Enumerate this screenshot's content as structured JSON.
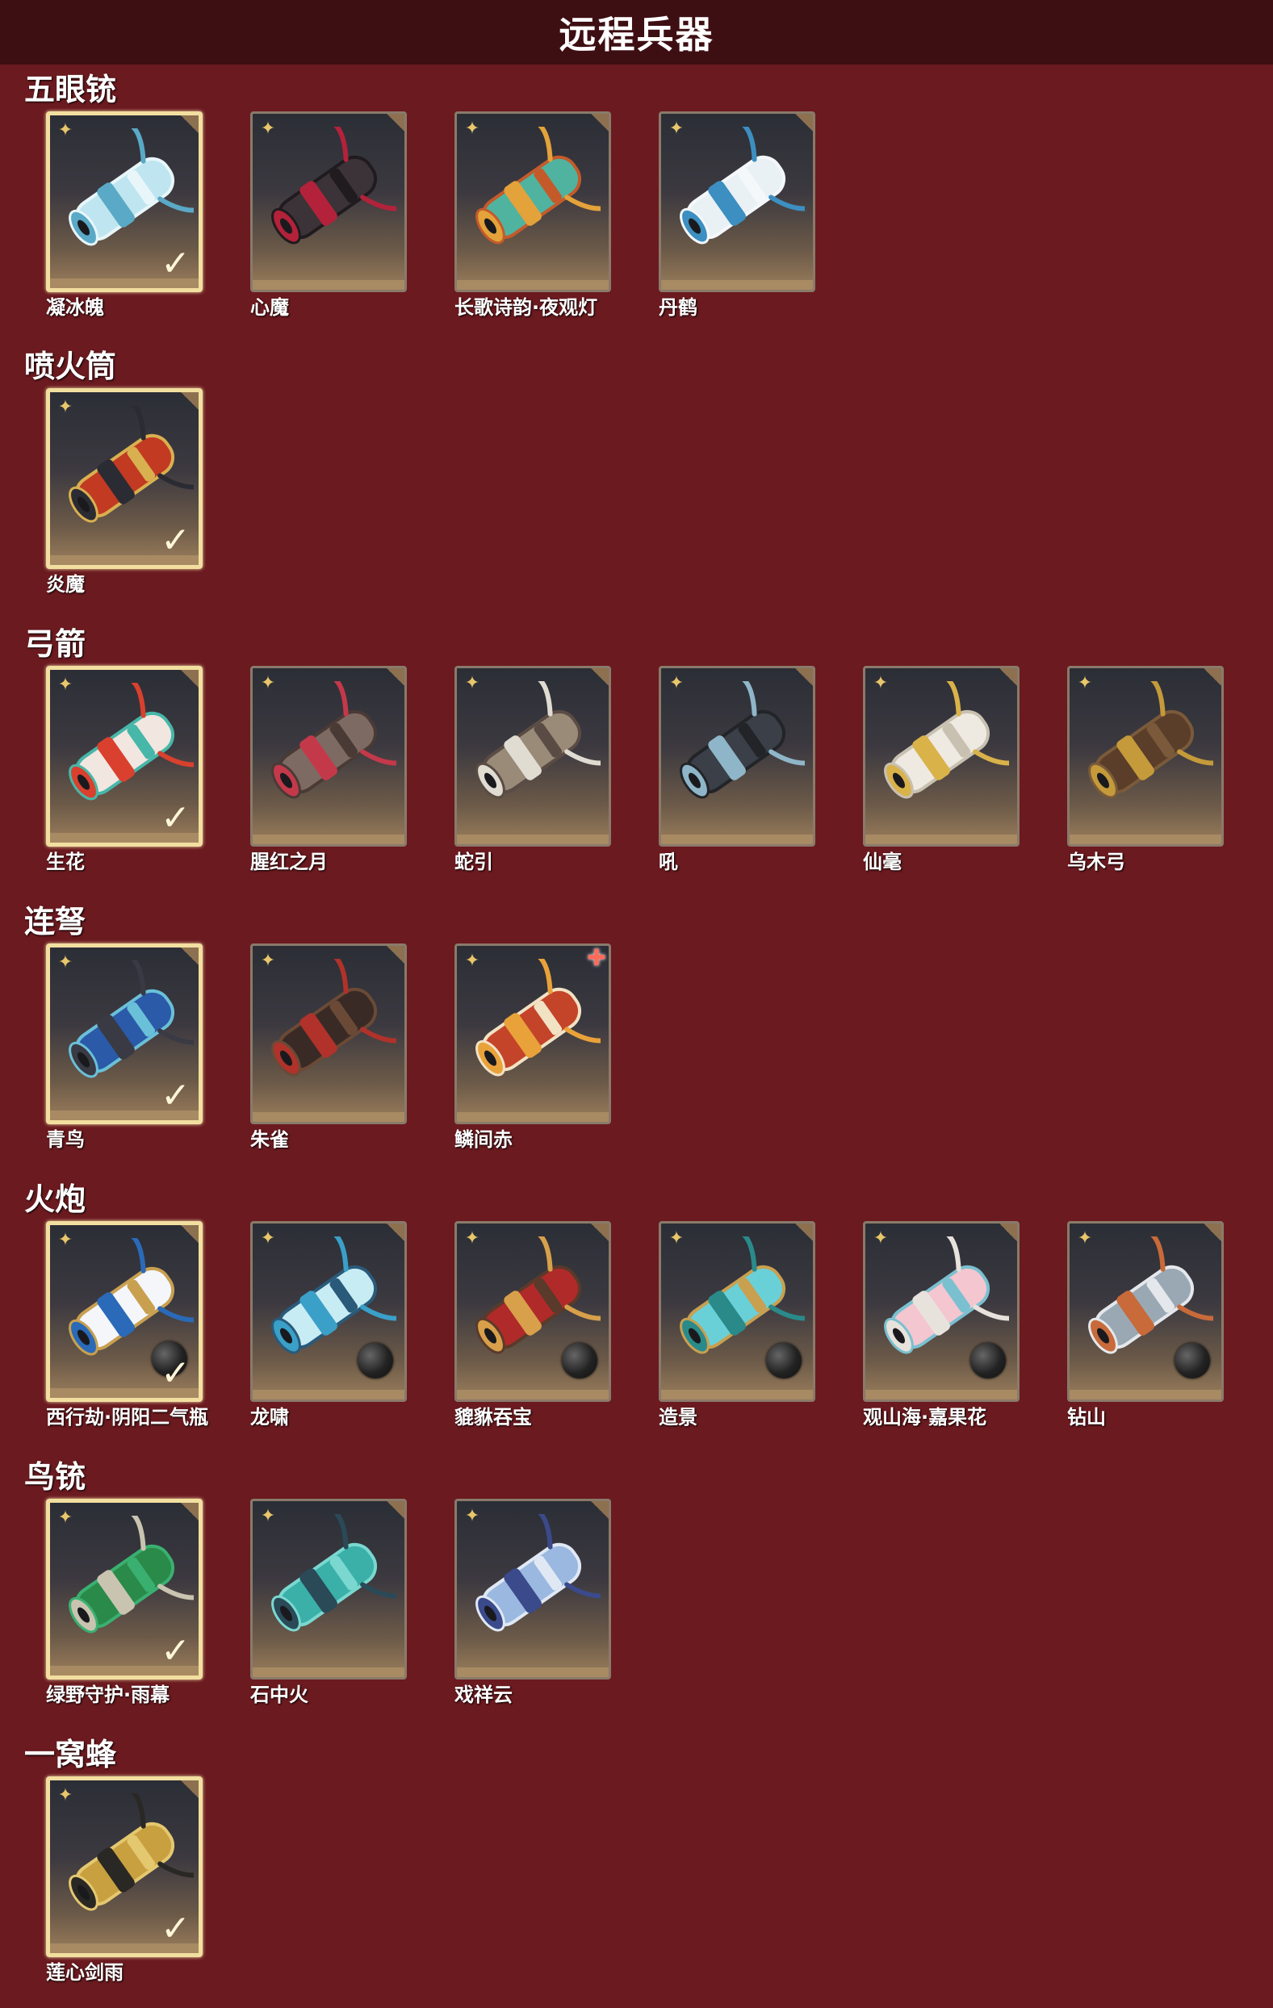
{
  "page_title": "远程兵器",
  "palette": {
    "background": "#6b1a1f",
    "title_bar": "#3d0e12",
    "owned_border": "#f2dfa0"
  },
  "sections": [
    {
      "title": "五眼铳",
      "items": [
        {
          "name": "凝冰魄",
          "owned": true,
          "art": [
            "#bfe6f0",
            "#5aa9c6",
            "#e8f6fa"
          ]
        },
        {
          "name": "心魔",
          "owned": false,
          "art": [
            "#3b3338",
            "#b3223a",
            "#1f1b1e"
          ]
        },
        {
          "name": "长歌诗韵·夜观灯",
          "owned": false,
          "art": [
            "#4fb3a0",
            "#e3a23a",
            "#c45a2a"
          ]
        },
        {
          "name": "丹鹤",
          "owned": false,
          "art": [
            "#e9f1f5",
            "#3c8fc0",
            "#f4f8fb"
          ]
        }
      ]
    },
    {
      "title": "喷火筒",
      "items": [
        {
          "name": "炎魔",
          "owned": true,
          "art": [
            "#c23a22",
            "#2b2b33",
            "#d8b050"
          ]
        }
      ]
    },
    {
      "title": "弓箭",
      "items": [
        {
          "name": "生花",
          "owned": true,
          "art": [
            "#f1e6e0",
            "#d9402e",
            "#46b7a8"
          ]
        },
        {
          "name": "腥红之月",
          "owned": false,
          "art": [
            "#7d6a62",
            "#c4394a",
            "#4a3a36"
          ]
        },
        {
          "name": "蛇引",
          "owned": false,
          "art": [
            "#9a8a78",
            "#e0dcd2",
            "#5a4c44"
          ]
        },
        {
          "name": "吼",
          "owned": false,
          "art": [
            "#3a3f48",
            "#8fb6c8",
            "#222428"
          ]
        },
        {
          "name": "仙毫",
          "owned": false,
          "art": [
            "#eeeae2",
            "#d9b24a",
            "#c8c0b0"
          ]
        },
        {
          "name": "乌木弓",
          "owned": false,
          "art": [
            "#5a3e2a",
            "#c59a3a",
            "#7a5a3a"
          ]
        }
      ]
    },
    {
      "title": "连弩",
      "items": [
        {
          "name": "青鸟",
          "owned": true,
          "art": [
            "#2a5aa8",
            "#3a3a44",
            "#6ac0d8"
          ]
        },
        {
          "name": "朱雀",
          "owned": false,
          "art": [
            "#3a2a26",
            "#b0322a",
            "#6a4a36"
          ]
        },
        {
          "name": "鳞间赤",
          "owned": false,
          "art": [
            "#c4442a",
            "#e9a23a",
            "#f1e2c4"
          ]
        }
      ],
      "plus_badge_item": 2
    },
    {
      "title": "火炮",
      "items": [
        {
          "name": "西行劫·阴阳二气瓶",
          "owned": true,
          "art": [
            "#f4f6fa",
            "#2a6ab8",
            "#c8a050"
          ]
        },
        {
          "name": "龙啸",
          "owned": false,
          "art": [
            "#c8ecf4",
            "#3aa0c8",
            "#2a5a7a"
          ]
        },
        {
          "name": "貔貅吞宝",
          "owned": false,
          "art": [
            "#b02a2a",
            "#d8a04a",
            "#5a3a2a"
          ]
        },
        {
          "name": "造景",
          "owned": false,
          "art": [
            "#6ad0d8",
            "#2a8a8a",
            "#c8a050"
          ]
        },
        {
          "name": "观山海·嘉果花",
          "owned": false,
          "art": [
            "#f4c6d0",
            "#e8e2dc",
            "#7ac0d0"
          ]
        },
        {
          "name": "钻山",
          "owned": false,
          "art": [
            "#9aa8b4",
            "#c86a3a",
            "#e4e8ec"
          ]
        }
      ],
      "ammo_balls": true
    },
    {
      "title": "鸟铳",
      "items": [
        {
          "name": "绿野守护·雨幕",
          "owned": true,
          "art": [
            "#2a8a4a",
            "#c8c4b0",
            "#3ab070"
          ]
        },
        {
          "name": "石中火",
          "owned": false,
          "art": [
            "#3ab0a8",
            "#2a4a58",
            "#7ad8d0"
          ]
        },
        {
          "name": "戏祥云",
          "owned": false,
          "art": [
            "#9ab8e0",
            "#3a4a8a",
            "#e0e8f4"
          ]
        }
      ]
    },
    {
      "title": "一窝蜂",
      "items": [
        {
          "name": "莲心剑雨",
          "owned": true,
          "art": [
            "#c8a040",
            "#2a2824",
            "#e4c870"
          ]
        }
      ]
    }
  ]
}
